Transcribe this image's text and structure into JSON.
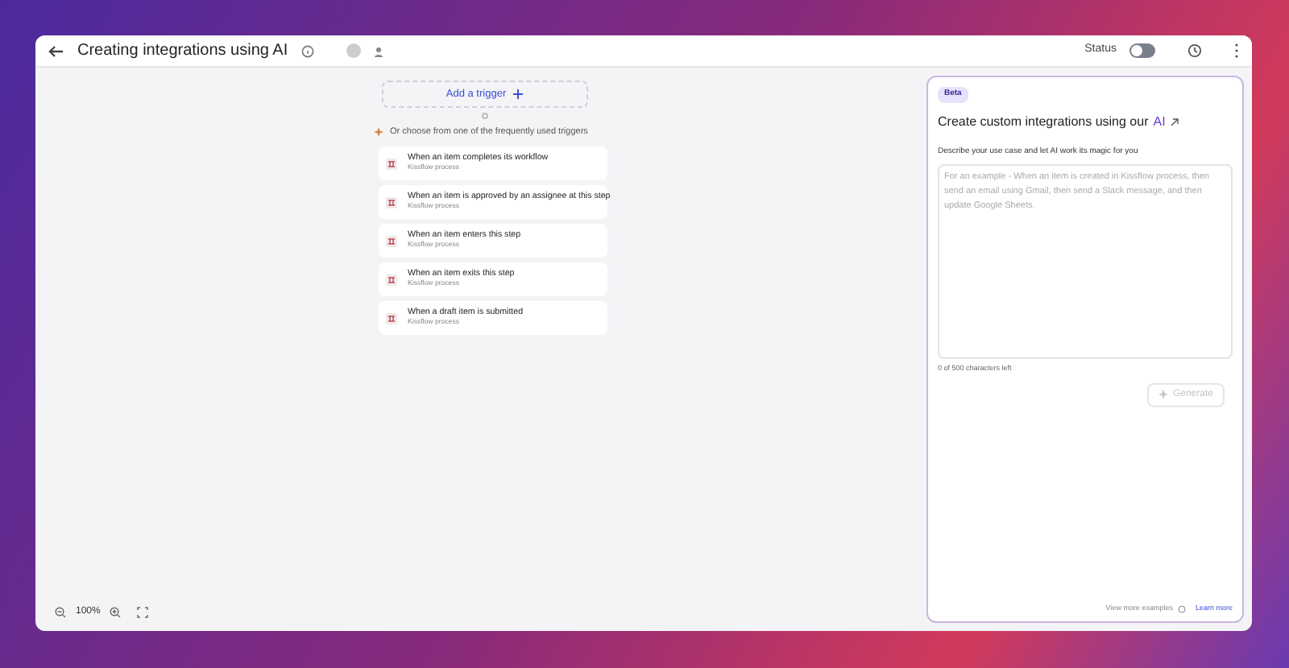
{
  "header": {
    "title": "Creating integrations using AI",
    "status_label": "Status",
    "status_on": false
  },
  "canvas": {
    "add_trigger": "Add a trigger",
    "hint": "Or choose from one of the frequently used triggers",
    "triggers": [
      {
        "title": "When an item completes its workflow",
        "subtitle": "Kissflow process"
      },
      {
        "title": "When an item is approved by an assignee at this step",
        "subtitle": "Kissflow process"
      },
      {
        "title": "When an item enters this step",
        "subtitle": "Kissflow process"
      },
      {
        "title": "When an item exits this step",
        "subtitle": "Kissflow process"
      },
      {
        "title": "When a draft item is submitted",
        "subtitle": "Kissflow process"
      }
    ],
    "zoom": "100%"
  },
  "panel": {
    "badge": "Beta",
    "heading": "Create custom integrations using our",
    "heading_accent": "AI",
    "label": "Describe your use case and let AI work its magic for you",
    "placeholder": "For an example - When an item is created in Kissflow process, then send an email using Gmail, then send a Slack message, and then update Google Sheets.",
    "counter": "0 of 500 characters left",
    "generate": "Generate",
    "generate_disabled": true,
    "more_examples": "View more examples",
    "learn_more": "Learn more"
  }
}
